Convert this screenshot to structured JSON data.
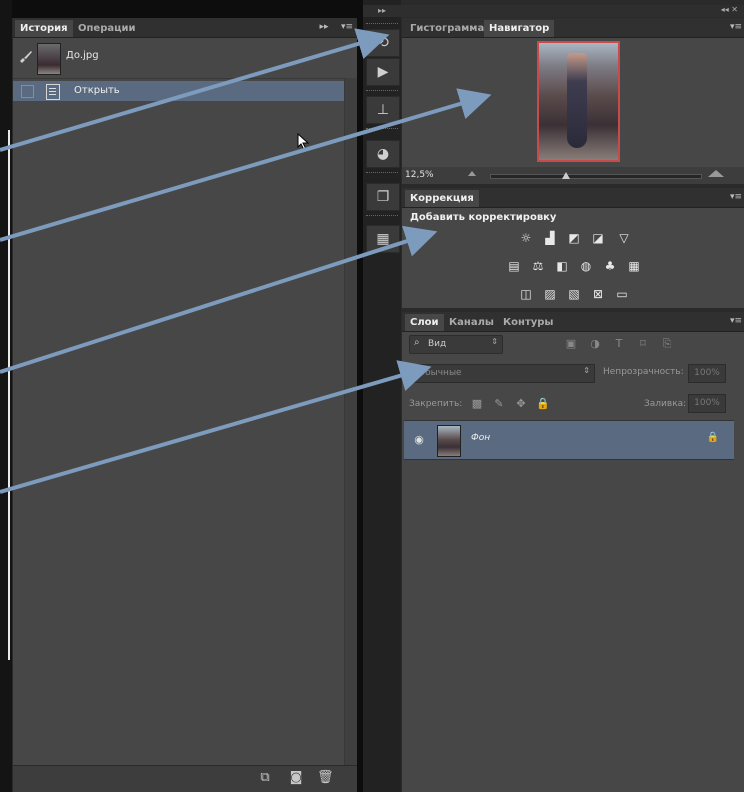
{
  "history_panel": {
    "tabs": [
      "История",
      "Операции"
    ],
    "snapshot_label": "До.jpg",
    "history_items": [
      {
        "label": "Открыть"
      }
    ],
    "bottom_actions": [
      "new-document-from-state-icon",
      "camera-snapshot-icon",
      "trash-icon"
    ]
  },
  "dock": {
    "items": [
      "history-icon",
      "play-actions-icon",
      "tool-presets-icon",
      "swatches-icon",
      "styles-icon",
      "grid-icon"
    ]
  },
  "navigator_panel": {
    "tabs": [
      "Гистограмма",
      "Навигатор"
    ],
    "zoom": "12,5%"
  },
  "adjustments_panel": {
    "tab": "Коррекция",
    "title": "Добавить корректировку"
  },
  "layers_panel": {
    "tabs": [
      "Слои",
      "Каналы",
      "Контуры"
    ],
    "filter_label": "Вид",
    "blend_mode": "Обычные",
    "opacity_label": "Непрозрачность:",
    "opacity_value": "100%",
    "lock_label": "Закрепить:",
    "fill_label": "Заливка:",
    "fill_value": "100%",
    "layers": [
      {
        "name": "Фон",
        "locked": true
      }
    ]
  },
  "colors": {
    "panel_bg": "#474747",
    "selected_row": "#5a6a80",
    "arrow": "#7d9bbd",
    "highlight_frame": "#c84a4a"
  }
}
